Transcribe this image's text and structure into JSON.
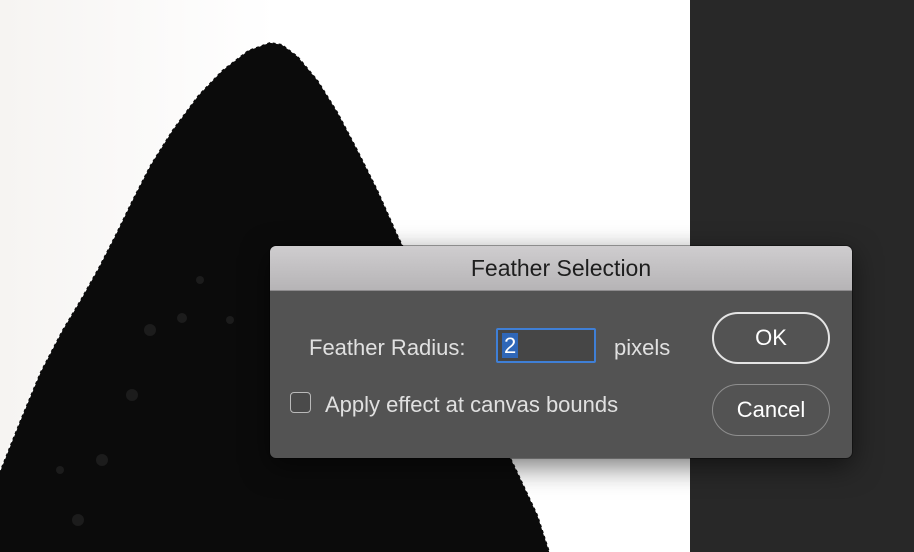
{
  "dialog": {
    "title": "Feather Selection",
    "radius_label": "Feather Radius:",
    "radius_value": "2",
    "units_label": "pixels",
    "canvas_bounds_label": "Apply effect at canvas bounds",
    "canvas_bounds_checked": false,
    "ok_label": "OK",
    "cancel_label": "Cancel"
  },
  "colors": {
    "dialog_bg": "#535353",
    "titlebar": "#c4c2c4",
    "pasteboard": "#282828",
    "focus_ring": "#3f7fd6"
  }
}
